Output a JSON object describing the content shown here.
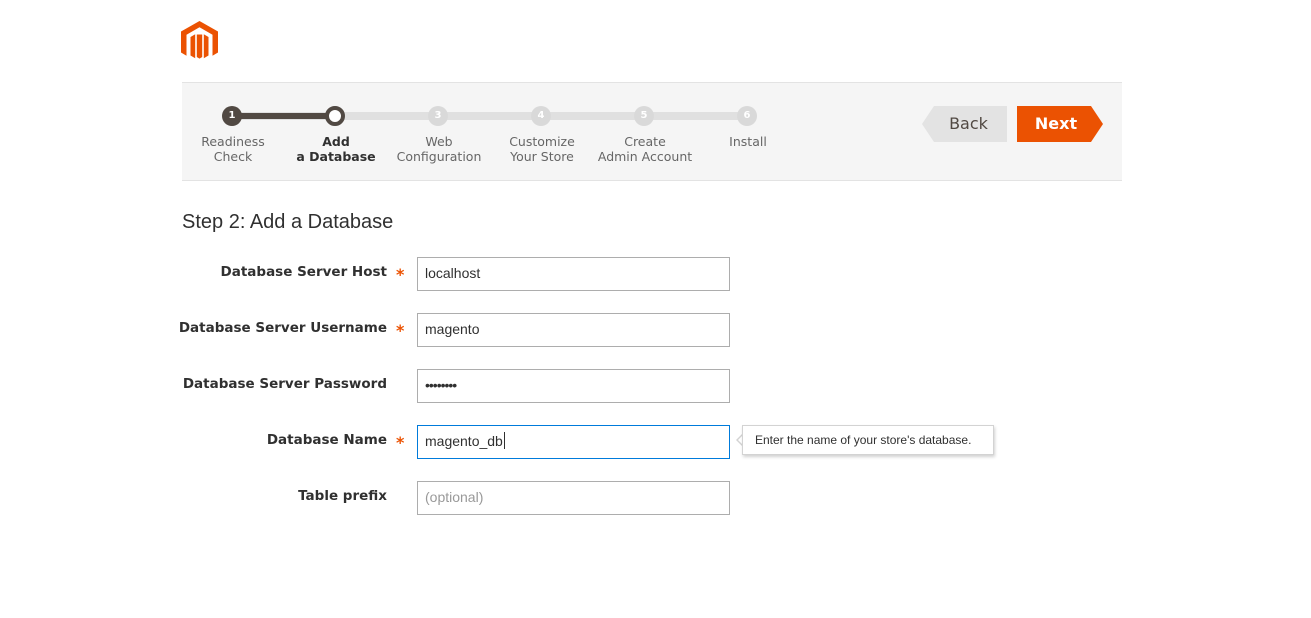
{
  "brand": {
    "logo_icon": "magento-logo-icon",
    "accent": "#eb5202"
  },
  "progress": {
    "current_step": 2,
    "steps": [
      {
        "number": "1",
        "label": "Readiness\nCheck",
        "state": "done"
      },
      {
        "number": "2",
        "label": "Add\na Database",
        "state": "active"
      },
      {
        "number": "3",
        "label": "Web\nConfiguration",
        "state": "pending"
      },
      {
        "number": "4",
        "label": "Customize\nYour Store",
        "state": "pending"
      },
      {
        "number": "5",
        "label": "Create\nAdmin Account",
        "state": "pending"
      },
      {
        "number": "6",
        "label": "Install",
        "state": "pending"
      }
    ]
  },
  "buttons": {
    "back_label": "Back",
    "next_label": "Next"
  },
  "page": {
    "title": "Step 2: Add a Database"
  },
  "form": {
    "db_host": {
      "label": "Database Server Host",
      "required": true,
      "value": "localhost"
    },
    "db_user": {
      "label": "Database Server Username",
      "required": true,
      "value": "magento"
    },
    "db_password": {
      "label": "Database Server Password",
      "required": false,
      "value": "••••••••"
    },
    "db_name": {
      "label": "Database Name",
      "required": true,
      "value": "magento_db"
    },
    "table_prefix": {
      "label": "Table prefix",
      "required": false,
      "value": "",
      "placeholder": "(optional)"
    }
  },
  "tooltip": {
    "text": "Enter the name of your store's database."
  },
  "required_marker": "*"
}
